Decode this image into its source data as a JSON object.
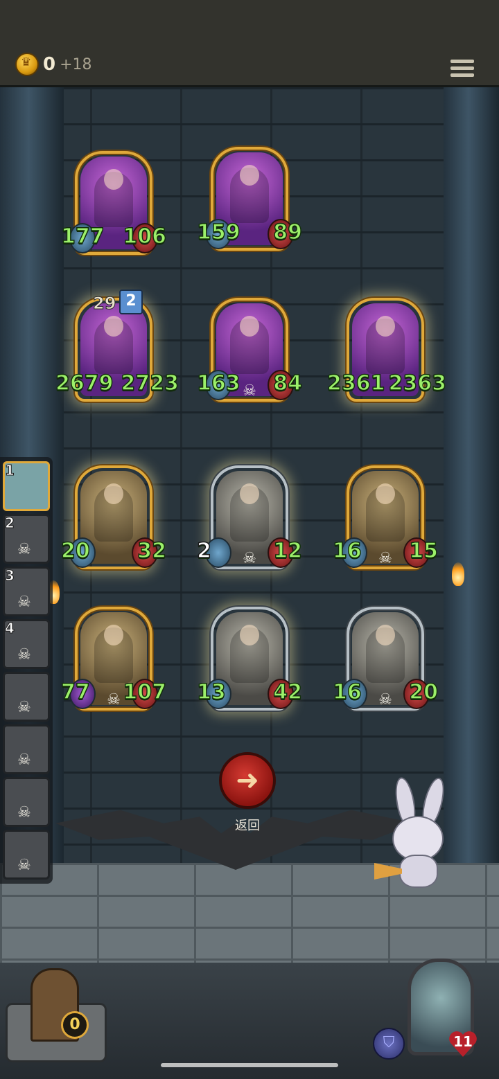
{
  "header": {
    "gold_value": "0",
    "gold_bonus": "+18",
    "gold_icon": "crown-coin-icon",
    "menu_icon": "hamburger-menu-icon"
  },
  "board": {
    "rows": [
      [
        {
          "id": "sorceress",
          "attack": "177",
          "health": "106",
          "skull": false,
          "tier": "",
          "badge": ""
        },
        {
          "id": "king",
          "attack": "159",
          "health": "89",
          "skull": false,
          "tier": "",
          "badge": ""
        }
      ],
      [
        {
          "id": "seahorse",
          "attack": "2679",
          "health": "2723",
          "skull": false,
          "tier": "29",
          "badge": "2"
        },
        {
          "id": "archer",
          "attack": "163",
          "health": "84",
          "skull": true,
          "tier": "",
          "badge": ""
        },
        {
          "id": "blonde-hero",
          "attack": "2361",
          "health": "2363",
          "skull": false,
          "tier": "",
          "badge": ""
        }
      ],
      [
        {
          "id": "shipwreck",
          "attack": "20",
          "health": "32",
          "skull": false
        },
        {
          "id": "thug",
          "attack": "2",
          "health": "12",
          "skull": true
        },
        {
          "id": "robot",
          "attack": "16",
          "health": "15",
          "skull": true
        }
      ],
      [
        {
          "id": "clock",
          "attack": "77",
          "health": "107",
          "skull": true
        },
        {
          "id": "clown",
          "attack": "13",
          "health": "42",
          "skull": false
        },
        {
          "id": "knight",
          "attack": "16",
          "health": "20",
          "skull": true
        }
      ]
    ]
  },
  "queue": {
    "slots": [
      {
        "num": "1",
        "active": true
      },
      {
        "num": "2",
        "active": false
      },
      {
        "num": "3",
        "active": false
      },
      {
        "num": "4",
        "active": false
      },
      {
        "num": "",
        "active": false
      },
      {
        "num": "",
        "active": false
      },
      {
        "num": "",
        "active": false
      },
      {
        "num": "",
        "active": false
      }
    ]
  },
  "actions": {
    "back_label": "返回",
    "back_icon": "arrow-left-icon"
  },
  "footer": {
    "chest_count": "0",
    "hero_health": "11",
    "armor_icon": "shield-icon"
  }
}
